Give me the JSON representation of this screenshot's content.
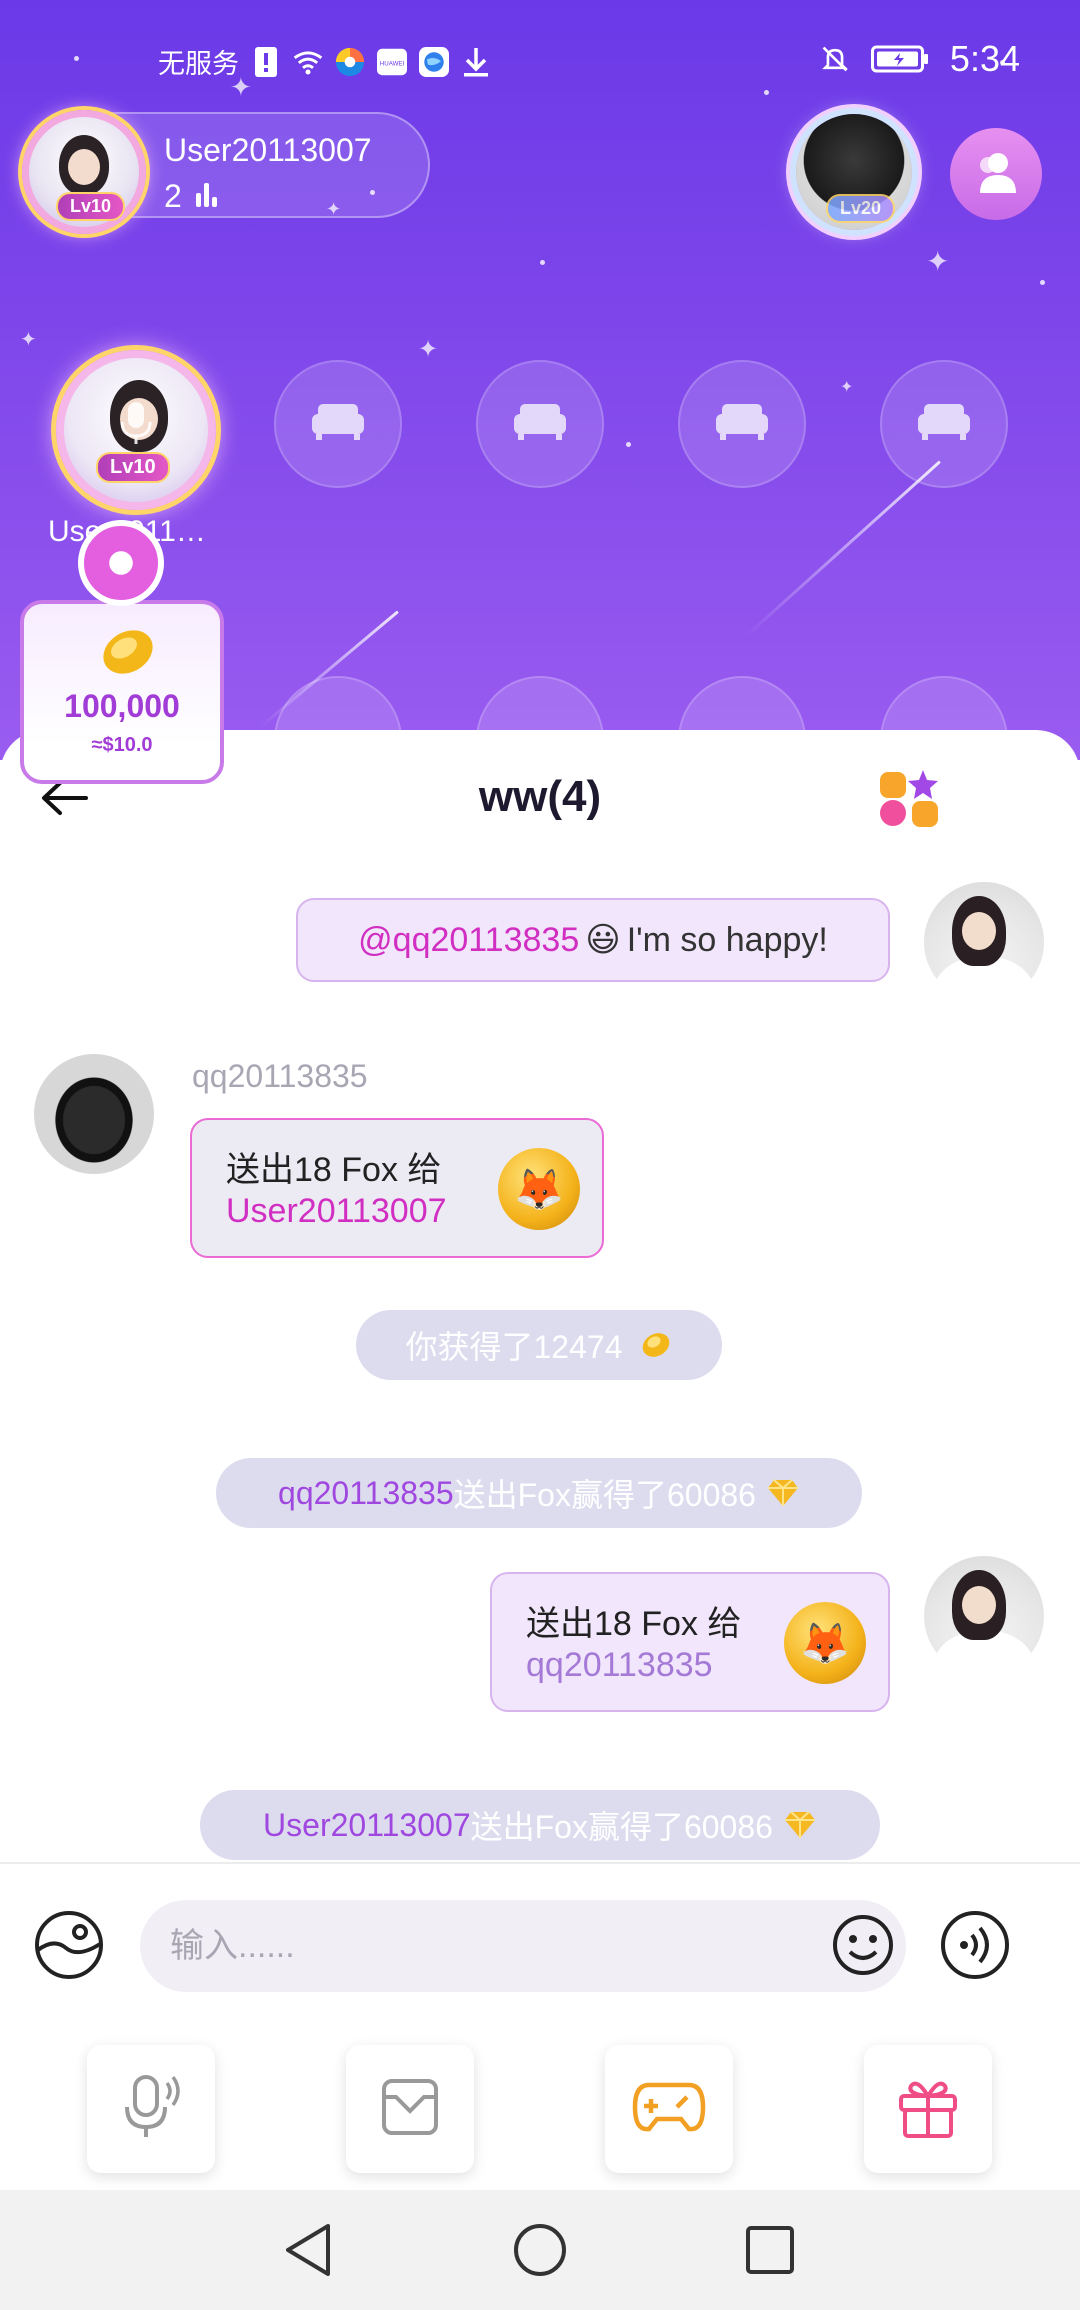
{
  "status_bar": {
    "carrier": "无服务",
    "time": "5:34",
    "icons": [
      "sim-alert-icon",
      "wifi-icon",
      "browser-icon",
      "huawei-icon",
      "globe-icon",
      "download-icon",
      "mute-icon",
      "battery-icon"
    ]
  },
  "host": {
    "name": "User20113007",
    "online_count": "2",
    "level": "Lv10"
  },
  "right_avatar": {
    "level": "Lv20"
  },
  "seat": {
    "name": "User2011…",
    "level": "Lv10"
  },
  "coins": {
    "amount": "100,000",
    "usd": "≈$10.0"
  },
  "chat": {
    "title": "ww(4)",
    "messages": {
      "m1": {
        "mention": "@qq20113835",
        "emoji": "😃",
        "text": " I'm so happy!"
      },
      "m2": {
        "sender": "qq20113835",
        "line1": "送出18 Fox 给",
        "recipient": "User20113007"
      },
      "m3": {
        "text": "你获得了12474"
      },
      "m4": {
        "name": "qq20113835",
        "rest": "送出Fox赢得了60086"
      },
      "m5": {
        "line1": "送出18 Fox 给",
        "recipient": "qq20113835"
      },
      "m6": {
        "name": "User20113007",
        "rest": "送出Fox赢得了60086"
      }
    }
  },
  "input": {
    "placeholder": "输入......"
  },
  "colors": {
    "accent": "#a13cd6",
    "mention": "#d12ec2",
    "top_gradient_start": "#6b39e8",
    "top_gradient_end": "#9a5cf0"
  }
}
